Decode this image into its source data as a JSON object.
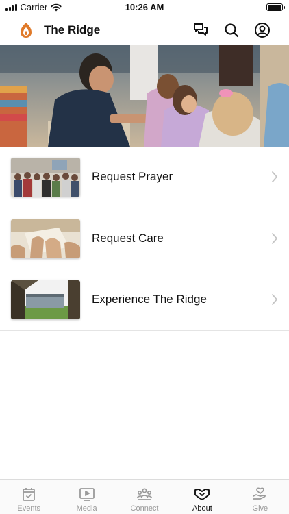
{
  "status_bar": {
    "carrier": "Carrier",
    "time": "10:26 AM"
  },
  "header": {
    "title": "The Ridge"
  },
  "colors": {
    "brand": "#e07a2a",
    "text": "#111111",
    "inactive": "#9a9a9a"
  },
  "nav_icons": [
    "chat-icon",
    "search-icon",
    "profile-icon"
  ],
  "list": {
    "items": [
      {
        "label": "Request Prayer",
        "thumb": "prayer-group-photo"
      },
      {
        "label": "Request Care",
        "thumb": "praying-hands-photo"
      },
      {
        "label": "Experience The Ridge",
        "thumb": "church-building-photo"
      }
    ]
  },
  "tabs": [
    {
      "label": "Events",
      "icon": "calendar-icon",
      "active": false
    },
    {
      "label": "Media",
      "icon": "tv-play-icon",
      "active": false
    },
    {
      "label": "Connect",
      "icon": "group-icon",
      "active": false
    },
    {
      "label": "About",
      "icon": "handshake-icon",
      "active": true
    },
    {
      "label": "Give",
      "icon": "giving-hand-icon",
      "active": false
    }
  ]
}
